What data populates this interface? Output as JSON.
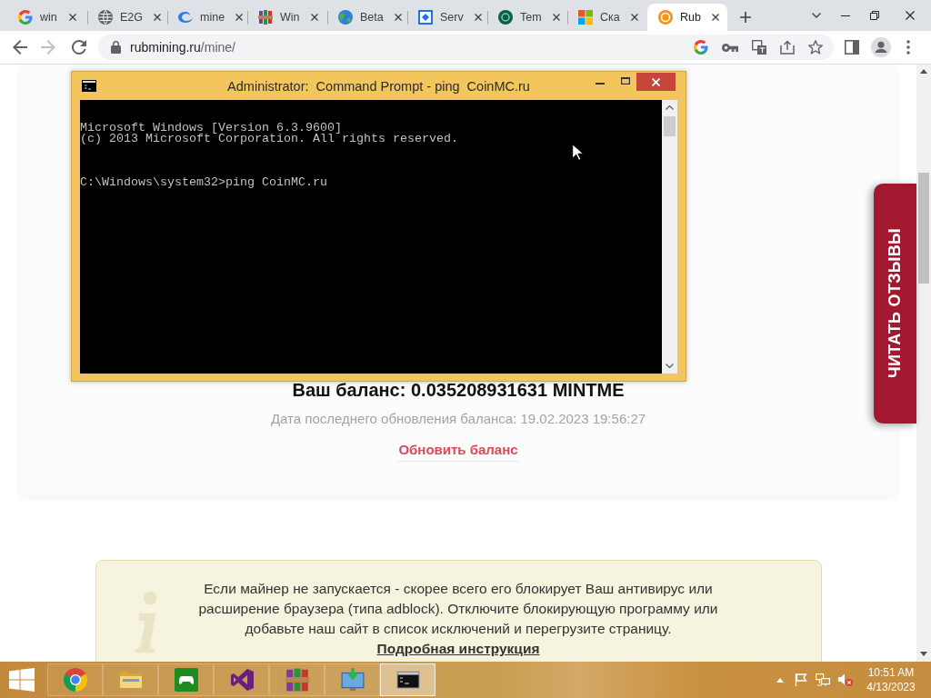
{
  "browser": {
    "tabs": [
      {
        "kind": "gletter",
        "title": "win",
        "selected": false
      },
      {
        "kind": "globe",
        "title": "E2G",
        "selected": false
      },
      {
        "kind": "swirl",
        "title": "mine",
        "selected": false
      },
      {
        "kind": "books",
        "title": "Win",
        "selected": false
      },
      {
        "kind": "earth",
        "title": "Beta",
        "selected": false
      },
      {
        "kind": "frame",
        "title": "Serv",
        "selected": false
      },
      {
        "kind": "disc",
        "title": "Tem",
        "selected": false
      },
      {
        "kind": "squares",
        "title": "Ска",
        "selected": false
      },
      {
        "kind": "coin",
        "title": "Rub",
        "selected": true
      }
    ],
    "forward_button": {
      "disabled": true
    },
    "address": {
      "host": "rubmining.ru",
      "path": "/mine/"
    }
  },
  "page": {
    "balance": "Ваш баланс: 0.035208931631 MINTME",
    "updated": "Дата последнего обновления баланса: 19.02.2023 19:56:27",
    "refresh_link": "Обновить баланс",
    "notice": {
      "text": "Если майнер не запускается - скорее всего его блокирует Ваш антивирус или расширение браузера (типа adblock). Отключите блокирующую программу или добавьте наш сайт в список исключений и перегрузите страницу.",
      "link": "Подробная инструкция"
    },
    "reviews_tab": "ЧИТАТЬ ОТЗЫВЫ"
  },
  "cmd_window": {
    "title": "Administrator:  Command Prompt - ping  CoinMC.ru",
    "output": [
      "Microsoft Windows [Version 6.3.9600]",
      "(c) 2013 Microsoft Corporation. All rights reserved."
    ],
    "prompt": "C:\\Windows\\system32>ping CoinMC.ru"
  },
  "taskbar": {
    "apps": [
      {
        "kind": "browser",
        "selected": false
      },
      {
        "kind": "folder",
        "selected": false
      },
      {
        "kind": "gamepad",
        "selected": false
      },
      {
        "kind": "studio",
        "selected": false
      },
      {
        "kind": "archive",
        "selected": false
      },
      {
        "kind": "installer",
        "selected": false
      },
      {
        "kind": "console",
        "selected": true
      }
    ],
    "tray": {
      "volume_muted": true
    },
    "clock": {
      "time": "10:51 AM",
      "date": "4/13/2023"
    }
  }
}
